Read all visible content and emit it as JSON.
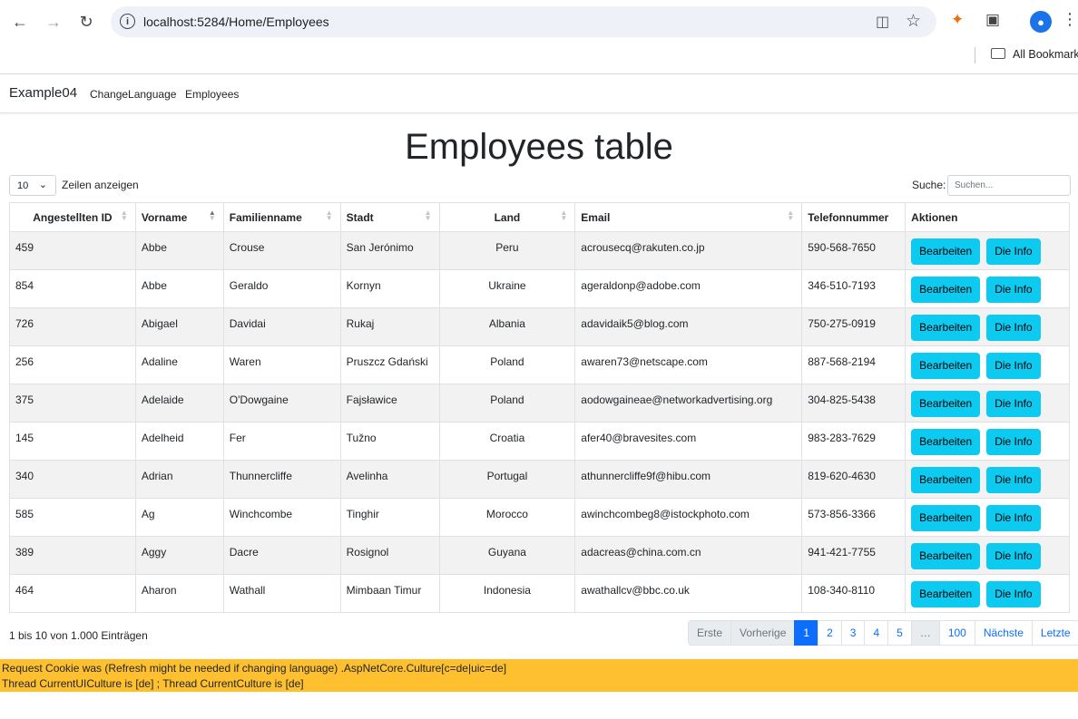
{
  "browser": {
    "url": "localhost:5284/Home/Employees",
    "bookmarks_label": "All Bookmarks"
  },
  "navbar": {
    "brand": "Example04",
    "links": [
      "ChangeLanguage",
      "Employees"
    ]
  },
  "page_title": "Employees table",
  "length": {
    "value": "10",
    "label": "Zeilen anzeigen"
  },
  "search": {
    "label": "Suche:",
    "placeholder": "Suchen..."
  },
  "table": {
    "columns": [
      "Angestellten ID",
      "Vorname",
      "Familienname",
      "Stadt",
      "Land",
      "Email",
      "Telefonnummer",
      "Aktionen"
    ],
    "edit_label": "Bearbeiten",
    "details_label": "Die Info",
    "rows": [
      [
        "459",
        "Abbe",
        "Crouse",
        "San Jerónimo",
        "Peru",
        "acrousecq@rakuten.co.jp",
        "590-568-7650"
      ],
      [
        "854",
        "Abbe",
        "Geraldo",
        "Kornyn",
        "Ukraine",
        "ageraldonp@adobe.com",
        "346-510-7193"
      ],
      [
        "726",
        "Abigael",
        "Davidai",
        "Rukaj",
        "Albania",
        "adavidaik5@blog.com",
        "750-275-0919"
      ],
      [
        "256",
        "Adaline",
        "Waren",
        "Pruszcz Gdański",
        "Poland",
        "awaren73@netscape.com",
        "887-568-2194"
      ],
      [
        "375",
        "Adelaide",
        "O'Dowgaine",
        "Fajsławice",
        "Poland",
        "aodowgaineae@networkadvertising.org",
        "304-825-5438"
      ],
      [
        "145",
        "Adelheid",
        "Fer",
        "Tužno",
        "Croatia",
        "afer40@bravesites.com",
        "983-283-7629"
      ],
      [
        "340",
        "Adrian",
        "Thunnercliffe",
        "Avelinha",
        "Portugal",
        "athunnercliffe9f@hibu.com",
        "819-620-4630"
      ],
      [
        "585",
        "Ag",
        "Winchcombe",
        "Tinghir",
        "Morocco",
        "awinchcombeg8@istockphoto.com",
        "573-856-3366"
      ],
      [
        "389",
        "Aggy",
        "Dacre",
        "Rosignol",
        "Guyana",
        "adacreas@china.com.cn",
        "941-421-7755"
      ],
      [
        "464",
        "Aharon",
        "Wathall",
        "Mimbaan Timur",
        "Indonesia",
        "awathallcv@bbc.co.uk",
        "108-340-8110"
      ]
    ]
  },
  "info": "1 bis 10 von 1.000 Einträgen",
  "pagination": {
    "first": "Erste",
    "previous": "Vorherige",
    "pages": [
      "1",
      "2",
      "3",
      "4",
      "5",
      "…",
      "100"
    ],
    "active": "1",
    "next": "Nächste",
    "last": "Letzte"
  },
  "footer": {
    "line1": "Request Cookie was (Refresh might be needed if changing language) .AspNetCore.Culture[c=de|uic=de]",
    "line2": "Thread CurrentUICulture is [de] ; Thread CurrentCulture is [de]"
  },
  "colors": {
    "accent": "#0d6efd",
    "info_button": "#0dcaf0",
    "footer_bg": "#ffc02f"
  }
}
